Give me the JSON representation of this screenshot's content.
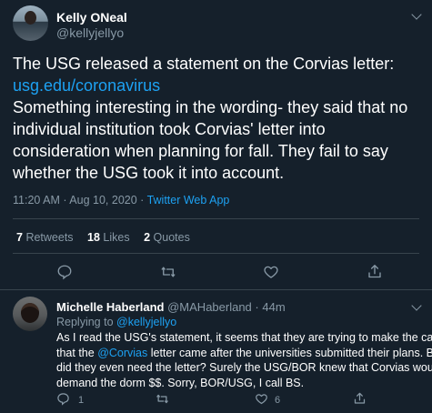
{
  "main_tweet": {
    "author_name": "Kelly ONeal",
    "author_handle": "@kellyjellyo",
    "text_line1": "The USG released a statement on the Corvias letter:",
    "link": "usg.edu/coronavirus",
    "text_lines": [
      "Something interesting in the wording- they said that no",
      "individual institution took Corvias' letter into",
      "consideration when planning for fall. They fail to say",
      "whether the USG took it into account."
    ],
    "timestamp": "11:20 AM · Aug 10, 2020 · ",
    "source_app": "Twitter Web App",
    "stats": {
      "retweets_count": "7",
      "retweets_label": "Retweets",
      "likes_count": "18",
      "likes_label": "Likes",
      "quotes_count": "2",
      "quotes_label": "Quotes"
    }
  },
  "reply_tweet": {
    "author_name": "Michelle Haberland",
    "author_handle": "@MAHaberland",
    "time": "· 44m",
    "replying_prefix": "Replying to ",
    "replying_handle": "@kellyjellyo",
    "line1": "As I read the USG's statement, it seems that they are trying to make the case",
    "line2_pre": "that the ",
    "line2_mention": "@Corvias",
    "line2_post": " letter came after the universities submitted their plans. But",
    "line3": "did they even need the letter? Surely the USG/BOR knew that Corvias would",
    "line4": "demand the dorm $$. Sorry, BOR/USG, I call BS.",
    "reply_count": "1",
    "like_count": "6"
  },
  "colors": {
    "background": "#15202b",
    "accent": "#1da1f2",
    "secondary_text": "#8899a6",
    "divider": "#38444d"
  },
  "icons": [
    "reply-icon",
    "retweet-icon",
    "like-icon",
    "share-icon",
    "chevron-down-icon"
  ]
}
